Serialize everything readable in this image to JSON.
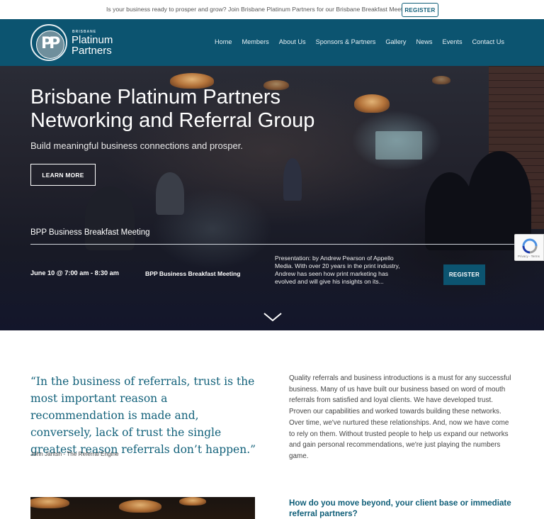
{
  "topbar": {
    "message": "Is your business ready to prosper and grow? Join Brisbane Platinum Partners for our Brisbane Breakfast Meeting",
    "register_label": "REGISTER"
  },
  "header": {
    "logo": {
      "small_text": "BRISBANE",
      "line1": "Platinum",
      "line2": "Partners",
      "monogram": "PP"
    },
    "nav": [
      {
        "label": "Home"
      },
      {
        "label": "Members"
      },
      {
        "label": "About Us"
      },
      {
        "label": "Sponsors & Partners"
      },
      {
        "label": "Gallery"
      },
      {
        "label": "News"
      },
      {
        "label": "Events"
      },
      {
        "label": "Contact Us"
      }
    ]
  },
  "hero": {
    "title": "Brisbane Platinum Partners Networking and Referral Group",
    "subtitle": "Build meaningful business connections and prosper.",
    "cta_label": "LEARN MORE",
    "event_heading": "BPP Business Breakfast Meeting",
    "event": {
      "date": "June 10 @ 7:00 am - 8:30 am",
      "name": "BPP Business Breakfast Meeting",
      "description": "Presentation: by Andrew Pearson of Appello Media. With over 20 years in the print industry, Andrew has seen how print marketing has evolved and will give his insights on its...",
      "register_label": "REGISTER"
    }
  },
  "recaptcha": {
    "text": "Privacy - Terms"
  },
  "content": {
    "quote": "“In the business of referrals, trust is the most important reason a recommendation is made and, conversely, lack of trust the single greatest reason referrals don’t happen.”",
    "quote_author": "John Jantsh - The Referral Engine",
    "body": "Quality referrals and business introductions is a must for any successful business. Many of us have built our business based on word of mouth referrals from satisfied and loyal clients. We have developed trust. Proven our capabilities and worked towards building these networks. Over time, we've nurtured these relationships. And, now we have come to rely on them. Without trusted people to help us expand our networks and gain personal recommendations, we're just playing the numbers game.",
    "section_heading": "How do you move beyond, your client base or immediate referral partners?"
  },
  "colors": {
    "brand_teal": "#0c5470",
    "accent_text": "#12617a"
  },
  "icons": {
    "scroll": "chevron-down-icon",
    "recaptcha": "recaptcha-icon"
  }
}
